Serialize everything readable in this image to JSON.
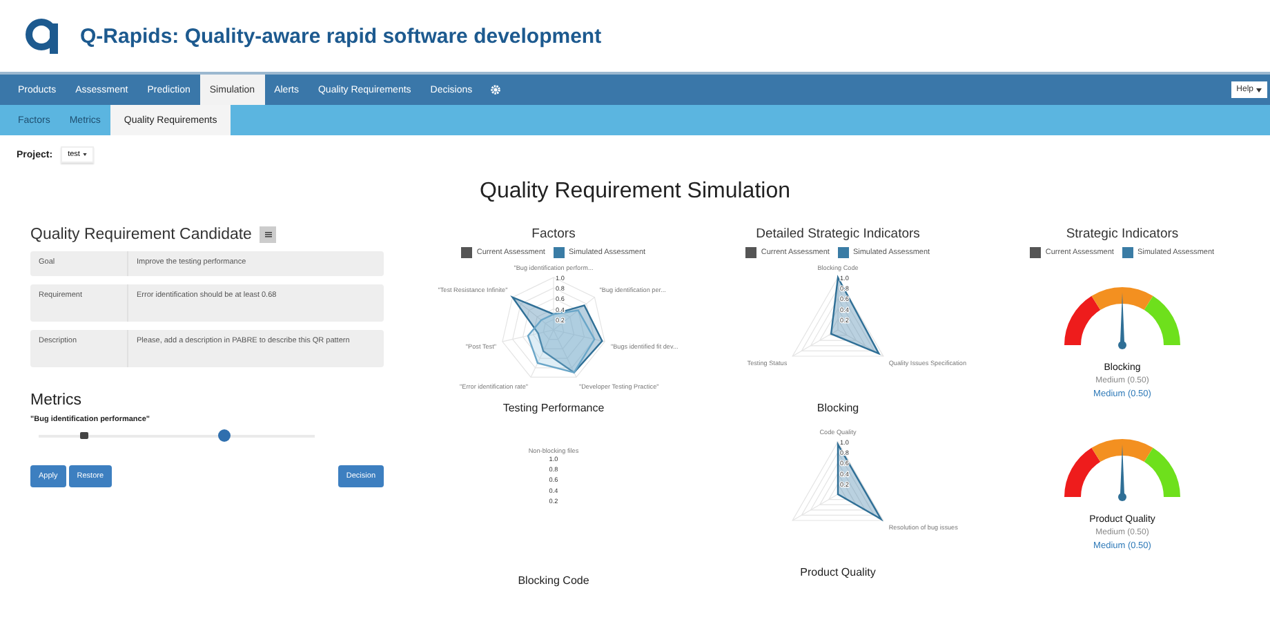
{
  "header": {
    "title": "Q-Rapids: Quality-aware rapid software development"
  },
  "nav": {
    "items": [
      {
        "label": "Products",
        "selected": false
      },
      {
        "label": "Assessment",
        "selected": false
      },
      {
        "label": "Prediction",
        "selected": false
      },
      {
        "label": "Simulation",
        "selected": true
      },
      {
        "label": "Alerts",
        "selected": false
      },
      {
        "label": "Quality Requirements",
        "selected": false
      },
      {
        "label": "Decisions",
        "selected": false
      }
    ],
    "help": "Help"
  },
  "subnav": [
    {
      "label": "Factors",
      "selected": false
    },
    {
      "label": "Metrics",
      "selected": false
    },
    {
      "label": "Quality Requirements",
      "selected": true
    }
  ],
  "project": {
    "label": "Project:",
    "value": "test"
  },
  "page_title": "Quality Requirement Simulation",
  "candidate": {
    "title": "Quality Requirement Candidate",
    "fields": [
      {
        "label": "Goal",
        "value": "Improve the testing performance"
      },
      {
        "label": "Requirement",
        "value": "Error identification should be at least 0.68"
      },
      {
        "label": "Description",
        "value": "Please, add a description in PABRE to describe this QR pattern"
      }
    ]
  },
  "metrics": {
    "title": "Metrics",
    "items": [
      {
        "name": "\"Bug identification performance\"",
        "level": 0.67
      }
    ]
  },
  "buttons": [
    {
      "label": "Apply"
    },
    {
      "label": "Restore"
    },
    {
      "label": "Decision"
    }
  ],
  "columns": [
    {
      "title": "Factors",
      "legend": [
        {
          "label": "Current Assessment",
          "color": "#555555"
        },
        {
          "label": "Simulated Assessment",
          "color": "#3a7ca5"
        }
      ],
      "charts": [
        {
          "kind": "radar7",
          "title": "Testing Performance",
          "ticks": [
            "1.0",
            "0.8",
            "0.6",
            "0.4",
            "0.2"
          ],
          "axes": [
            "\"Bug identification perform...",
            "\"Test Resistance Infinite\"",
            "\"Bug identification per...",
            "\"Post Test\"",
            "\"Bugs identified fit dev...",
            "\"Error identification rate\"",
            "\"Developer Testing Practice\""
          ]
        },
        {
          "kind": "ticks",
          "title": "Blocking Code",
          "ticks": [
            "1.0",
            "0.8",
            "0.6",
            "0.4",
            "0.2"
          ],
          "axes": [
            "Non-blocking files"
          ]
        }
      ]
    },
    {
      "title": "Detailed Strategic Indicators",
      "legend": [
        {
          "label": "Current Assessment",
          "color": "#555555"
        },
        {
          "label": "Simulated Assessment",
          "color": "#3a7ca5"
        }
      ],
      "charts": [
        {
          "kind": "radar3",
          "title": "Blocking",
          "ticks": [
            "1.0",
            "0.8",
            "0.6",
            "0.4",
            "0.2"
          ],
          "axes": [
            "Blocking Code",
            "Testing Status",
            "Quality Issues Specification"
          ]
        },
        {
          "kind": "radar3",
          "title": "Product Quality",
          "ticks": [
            "1.0",
            "0.8",
            "0.6",
            "0.4",
            "0.2"
          ],
          "axes": [
            "Code Quality",
            "Resolution of bug issues"
          ]
        }
      ]
    },
    {
      "title": "Strategic Indicators",
      "legend": [
        {
          "label": "Current Assessment",
          "color": "#555555"
        },
        {
          "label": "Simulated Assessment",
          "color": "#3a7ca5"
        }
      ],
      "gauges": [
        {
          "name": "Blocking",
          "current": "Medium (0.50)",
          "simulated": "Medium (0.50)",
          "level": 0.5
        },
        {
          "name": "Product Quality",
          "current": "Medium (0.50)",
          "simulated": "Medium (0.50)",
          "level": 0.5
        }
      ]
    }
  ]
}
